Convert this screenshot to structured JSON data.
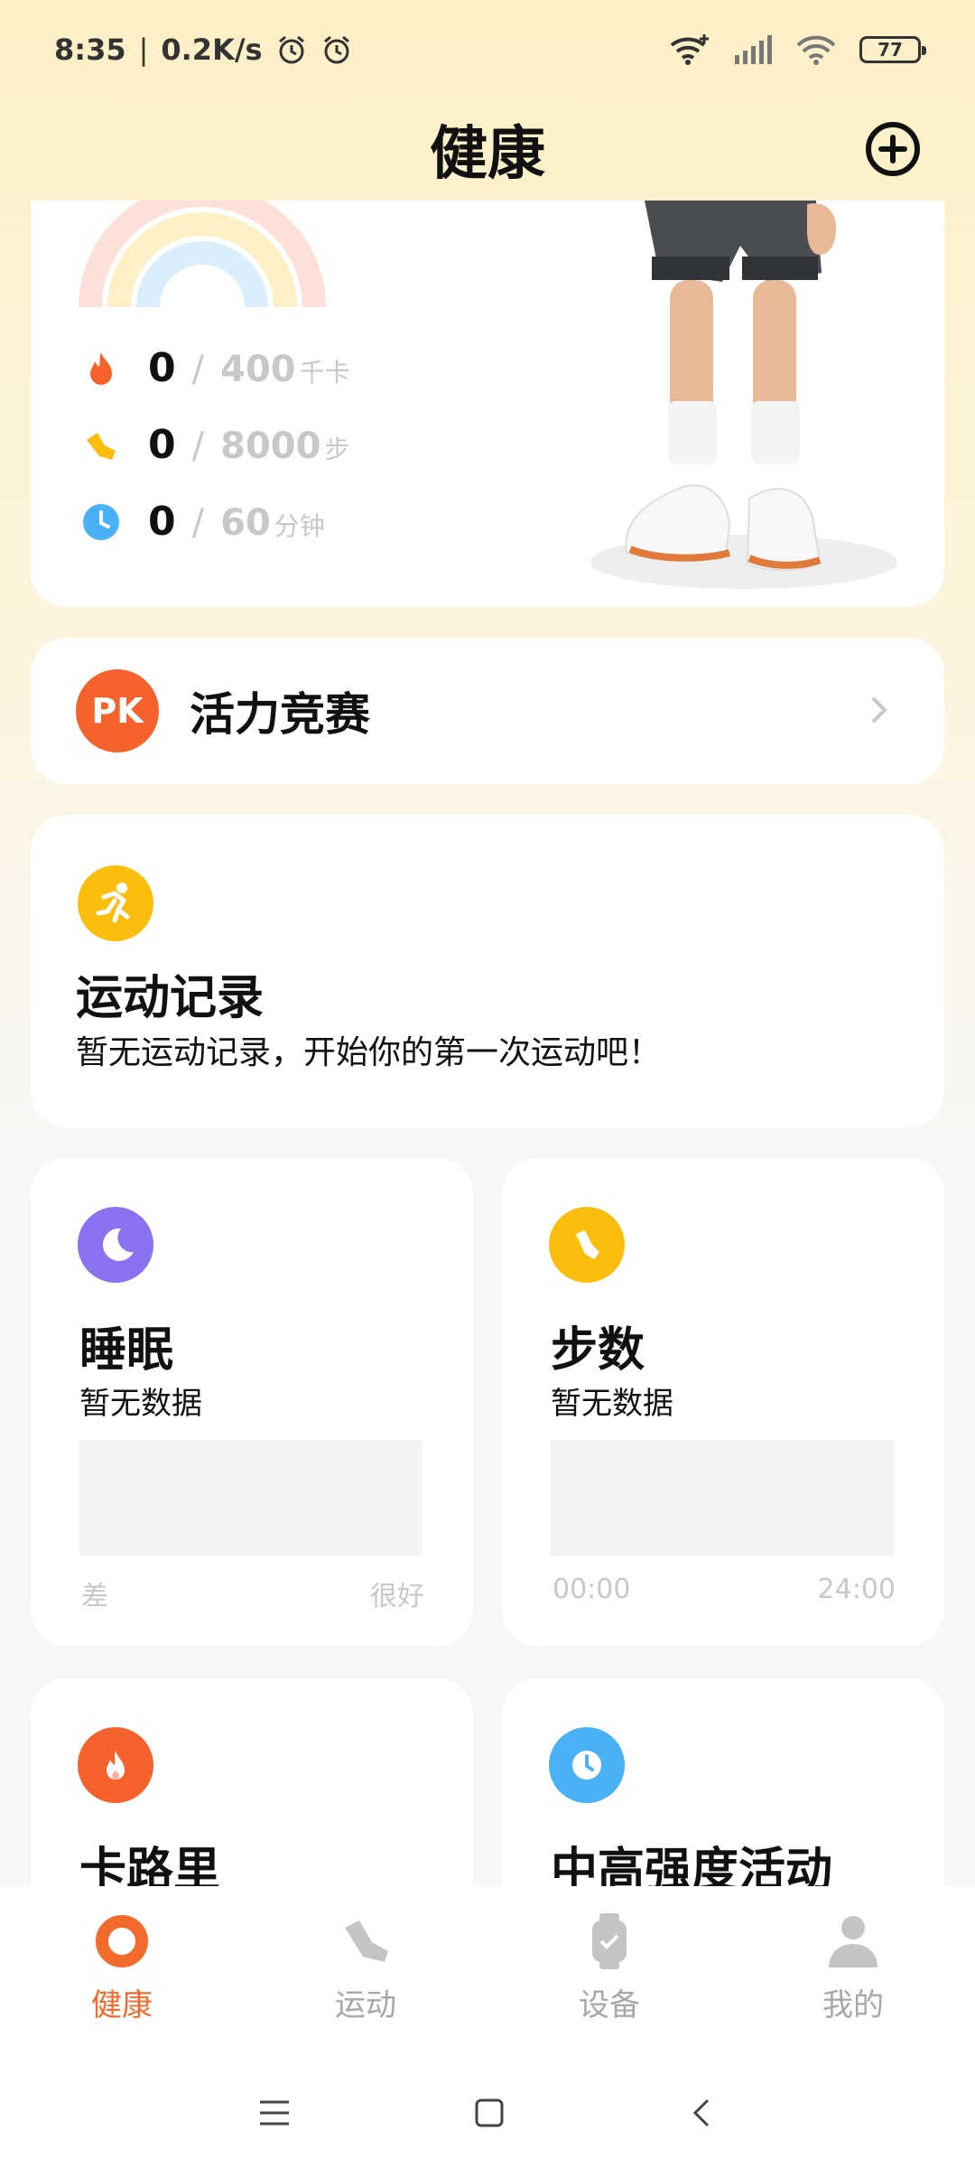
{
  "status": {
    "time": "8:35",
    "speed": "0.2K/s",
    "battery": "77"
  },
  "header": {
    "title": "健康"
  },
  "summary": {
    "calories": {
      "value": "0",
      "goal": "400",
      "unit": "千卡"
    },
    "steps": {
      "value": "0",
      "goal": "8000",
      "unit": "步"
    },
    "minutes": {
      "value": "0",
      "goal": "60",
      "unit": "分钟"
    }
  },
  "pk": {
    "badge": "PK",
    "label": "活力竞赛"
  },
  "exercise": {
    "title": "运动记录",
    "subtitle": "暂无运动记录，开始你的第一次运动吧！"
  },
  "sleep": {
    "title": "睡眠",
    "subtitle": "暂无数据",
    "axis_left": "差",
    "axis_right": "很好"
  },
  "steps_card": {
    "title": "步数",
    "subtitle": "暂无数据",
    "axis_left": "00:00",
    "axis_right": "24:00"
  },
  "calorie_card": {
    "title": "卡路里"
  },
  "activity_card": {
    "title": "中高强度活动"
  },
  "nav": [
    {
      "label": "健康"
    },
    {
      "label": "运动"
    },
    {
      "label": "设备"
    },
    {
      "label": "我的"
    }
  ],
  "colors": {
    "accent": "#f26a2c",
    "sleep": "#8b70f0",
    "steps": "#fbbd0e",
    "calorie": "#f5622b",
    "activity": "#49b1f5"
  }
}
